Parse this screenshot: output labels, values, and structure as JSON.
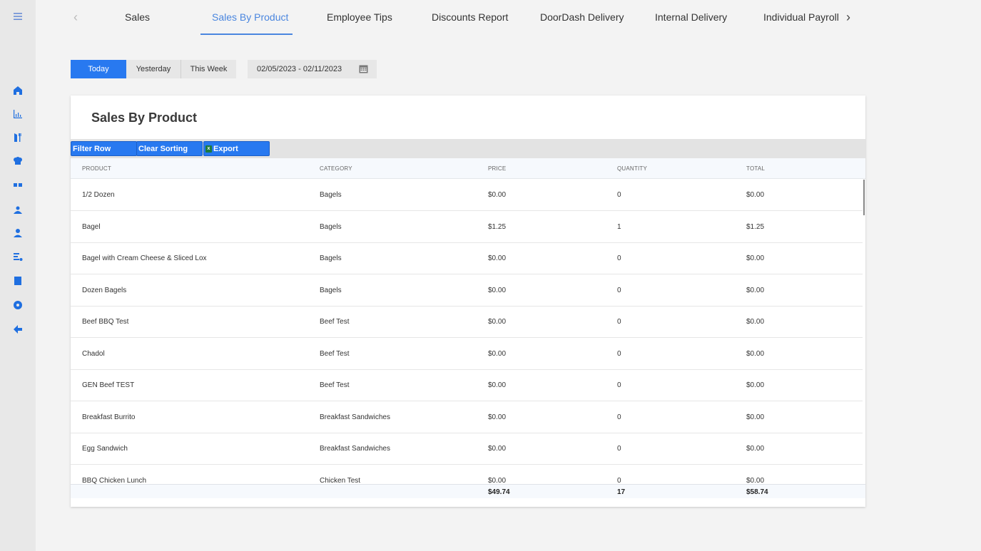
{
  "sidebar": {
    "icons": [
      "menu-icon",
      "home-icon",
      "chart-icon",
      "dining-icon",
      "chef-icon",
      "tags-icon",
      "users-icon",
      "person-icon",
      "list-icon",
      "report-icon",
      "settings-icon",
      "back-arrow-icon"
    ]
  },
  "tabs": {
    "prev_arrow": "‹",
    "next_arrow": "›",
    "items": [
      "Sales",
      "Sales By Product",
      "Employee Tips",
      "Discounts Report",
      "DoorDash Delivery",
      "Internal Delivery",
      "Individual Payroll"
    ],
    "active": "Sales By Product"
  },
  "range": {
    "buttons": [
      "Today",
      "Yesterday",
      "This Week"
    ],
    "active": "Today",
    "date_range": "02/05/2023 - 02/11/2023"
  },
  "card": {
    "title": "Sales By Product",
    "toolbar": {
      "filter_row": "Filter Row",
      "clear_sorting": "Clear Sorting",
      "export": "Export",
      "export_icon_text": "x"
    },
    "columns": [
      "PRODUCT",
      "CATEGORY",
      "PRICE",
      "QUANTITY",
      "TOTAL"
    ],
    "rows": [
      [
        "1/2 Dozen",
        "Bagels",
        "$0.00",
        "0",
        "$0.00"
      ],
      [
        "Bagel",
        "Bagels",
        "$1.25",
        "1",
        "$1.25"
      ],
      [
        "Bagel with Cream Cheese & Sliced Lox",
        "Bagels",
        "$0.00",
        "0",
        "$0.00"
      ],
      [
        "Dozen Bagels",
        "Bagels",
        "$0.00",
        "0",
        "$0.00"
      ],
      [
        "Beef BBQ Test",
        "Beef Test",
        "$0.00",
        "0",
        "$0.00"
      ],
      [
        "Chadol",
        "Beef Test",
        "$0.00",
        "0",
        "$0.00"
      ],
      [
        "GEN Beef TEST",
        "Beef Test",
        "$0.00",
        "0",
        "$0.00"
      ],
      [
        "Breakfast Burrito",
        "Breakfast Sandwiches",
        "$0.00",
        "0",
        "$0.00"
      ],
      [
        "Egg Sandwich",
        "Breakfast Sandwiches",
        "$0.00",
        "0",
        "$0.00"
      ],
      [
        "BBQ Chicken Lunch",
        "Chicken Test",
        "$0.00",
        "0",
        "$0.00"
      ]
    ],
    "footer": {
      "price": "$49.74",
      "quantity": "17",
      "total": "$58.74"
    }
  },
  "colors": {
    "accent": "#2879f0",
    "tab_active": "#4a86df",
    "sidebar_icon": "#1f6fe0"
  }
}
